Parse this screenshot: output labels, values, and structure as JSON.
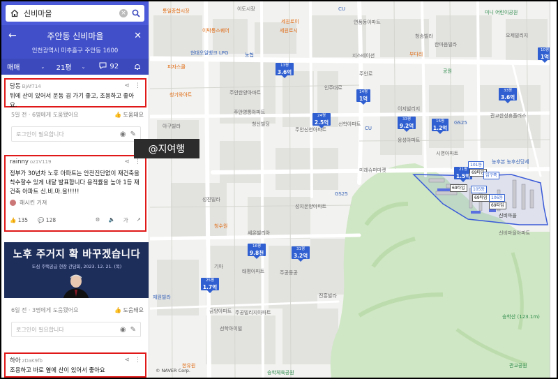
{
  "search": {
    "query": "신비마을"
  },
  "header": {
    "title": "주안동 신비마을",
    "address": "인천광역시 미추홀구 주안동 1600"
  },
  "tabs": {
    "deal": "매매",
    "size": "21평",
    "comments": "92"
  },
  "reviews": [
    {
      "user": "당동",
      "id": "BjAf714",
      "text": "뒤에 산이 있어서 운동 겸 가기 좋고, 조용하고 좋아요.",
      "time": "5일 전 · 6명에게 도움됐어요",
      "helpful": "도움돼요",
      "placeholder": "로그인이 필요합니다"
    },
    {
      "user": "rainny",
      "id": "oz1V119",
      "text": "정부가 30년차 노후 아파트는 안전진단없이 재건축을 착수할수 있게 내달 발표합니다  용적률을 높아 1등 재건축 아파트 신.비.마.을!!!!!",
      "reaction_partial": "해시킨 거져",
      "likes": "135",
      "replies": "128",
      "placeholder": "로그인이 필요합니다"
    },
    {
      "user": "하아",
      "id": "zDaK9fb",
      "text": "조용하고 바로 옆에 산이 있어서 좋아요",
      "time": "6일 전 · 3명에게 도움됐어요",
      "helpful": "도움돼요",
      "placeholder": "로그인이 필요합니다"
    }
  ],
  "banner": {
    "headline": "노후 주거지 확 바꾸겠습니다",
    "sub": "도심 주택공급 현장 간담회, 2023. 12. 21. (목)"
  },
  "watermark": "@지여행",
  "map": {
    "copyright": "© NAVER Corp.",
    "pins": [
      {
        "size": "13평",
        "value": "3.6억"
      },
      {
        "size": "14평",
        "value": "1억"
      },
      {
        "size": "24평",
        "value": "2.5억"
      },
      {
        "size": "33평",
        "value": "9.2억"
      },
      {
        "size": "16평",
        "value": "1.2억"
      },
      {
        "size": "33평",
        "value": "3.6억"
      },
      {
        "size": "10평",
        "value": "1억"
      },
      {
        "size": "21평",
        "value": "1.5억"
      },
      {
        "size": "16평",
        "value": "9.8천"
      },
      {
        "size": "31평",
        "value": "3.2억"
      },
      {
        "size": "25평",
        "value": "1.7억"
      }
    ],
    "tags": [
      "101동",
      "69타입",
      "입구쪽",
      "69타입",
      "105동",
      "69타입",
      "106동",
      "69타입"
    ],
    "labels": {
      "l1": "통일종합시장",
      "l2": "이도시장",
      "l3": "이박통스퀘어",
      "l4": "세원로이",
      "l5": "세원로시",
      "l6": "연품동아파트",
      "l7": "청송빌라",
      "l8": "한마음빌라",
      "l9": "부다리",
      "l10": "공원",
      "l11": "현대오일뱅크 LPG",
      "l12": "피자스쿨",
      "l13": "청기와아트",
      "l14": "농협",
      "l15": "지스테이션",
      "l16": "주안한양아파트",
      "l17": "아구빌라",
      "l18": "주안영통아파트",
      "l19": "청신빌딩",
      "l20": "주안신천아파트",
      "l21": "이지빌리지",
      "l22": "응성아파트",
      "l23": "시영아파트",
      "l24": "관교한성휴플러스",
      "l25": "미래슈퍼마켓",
      "l26": "GS25",
      "l27": "성진빌라",
      "l28": "성지온양아파트",
      "l29": "세온빌리아",
      "l30": "청수원",
      "l31": "태평아파트",
      "l32": "주공동공",
      "l33": "주공빌리지아파트",
      "l34": "진흥빌라",
      "l35": "금양아파트",
      "l36": "선학아이빌",
      "l37": "재원빌라",
      "l38": "한유원",
      "l39": "승학체육공원",
      "l40": "신비마을",
      "l41": "농후본 농후신당세",
      "l42": "승학산 (123.1m)",
      "l43": "관교공원",
      "l44": "CU",
      "l45": "GS25",
      "l46": "오제빌리지",
      "l47": "미니 어린이공원",
      "l48": "선학아파트",
      "l49": "기아",
      "l50": "CU",
      "l51": "인주대로",
      "l52": "주안로",
      "l53": "신비마을아파트"
    }
  }
}
